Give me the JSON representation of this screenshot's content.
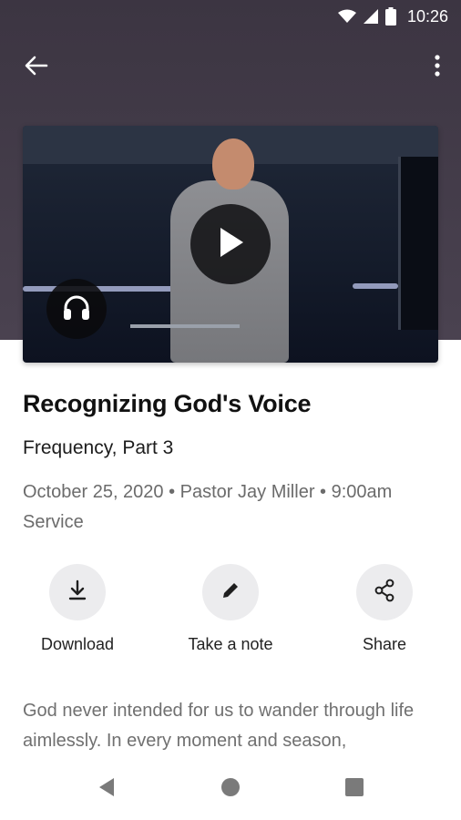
{
  "status_bar": {
    "time": "10:26",
    "icons": [
      "wifi-icon",
      "signal-icon",
      "battery-icon"
    ]
  },
  "toolbar": {
    "back_icon": "arrow-back-icon",
    "more_icon": "more-vertical-icon"
  },
  "media": {
    "play_icon": "play-icon",
    "audio_icon": "headphones-icon"
  },
  "sermon": {
    "title": "Recognizing God's Voice",
    "series": "Frequency, Part 3",
    "meta": "October 25, 2020 • Pastor Jay Miller • 9:00am Service"
  },
  "actions": [
    {
      "label": "Download",
      "icon": "download-icon"
    },
    {
      "label": "Take a note",
      "icon": "pencil-icon"
    },
    {
      "label": "Share",
      "icon": "share-icon"
    }
  ],
  "description": "God never intended for us to wander through life aimlessly. In every moment and season,",
  "colors": {
    "header_bg": "#3c3542",
    "action_circle": "#ececee",
    "title_text": "#111111",
    "meta_text": "#6b6b6b"
  },
  "nav": {
    "back_icon": "nav-back-icon",
    "home_icon": "nav-home-icon",
    "recents_icon": "nav-recents-icon"
  }
}
